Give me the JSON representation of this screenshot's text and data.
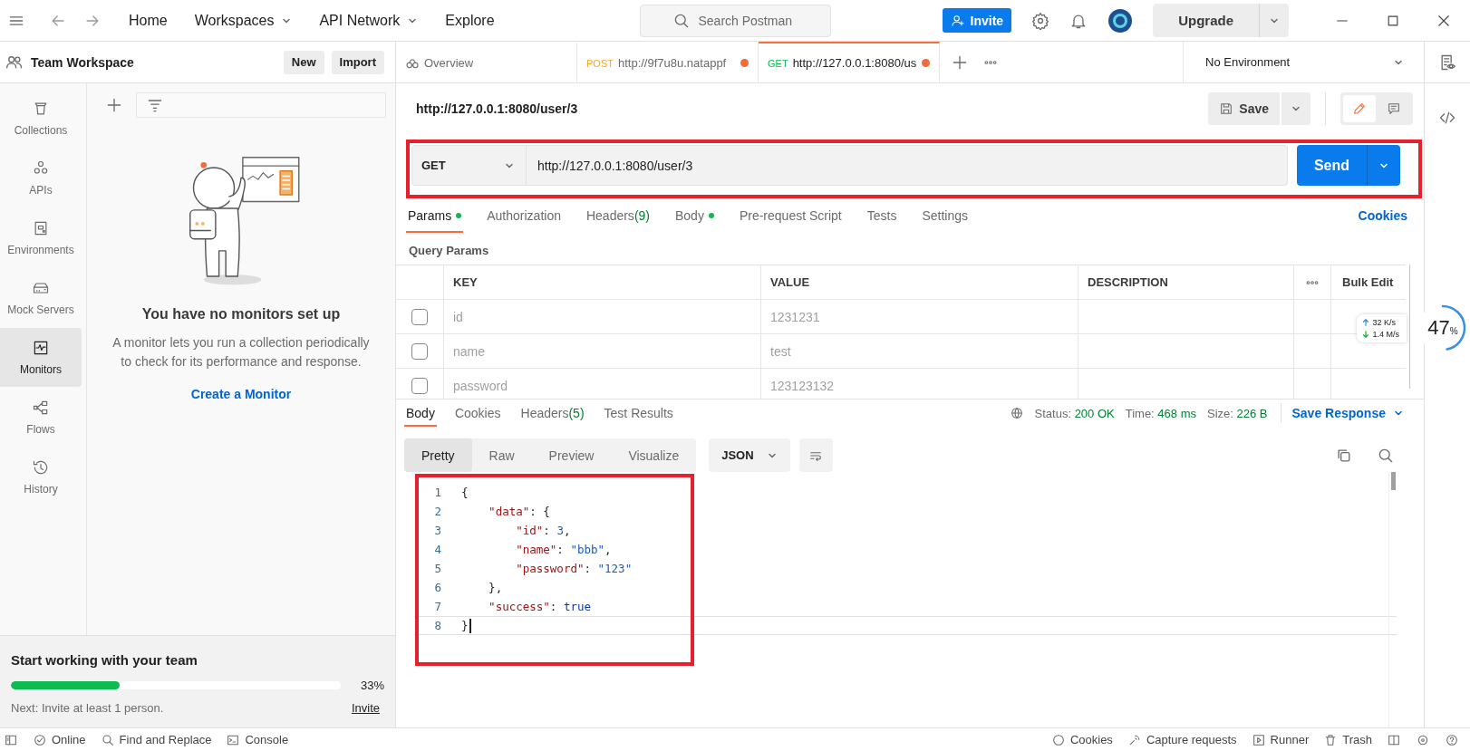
{
  "top_bar": {
    "nav": [
      {
        "label": "Home",
        "dropdown": false
      },
      {
        "label": "Workspaces",
        "dropdown": true
      },
      {
        "label": "API Network",
        "dropdown": true
      },
      {
        "label": "Explore",
        "dropdown": false
      }
    ],
    "search": {
      "placeholder": "Search Postman"
    },
    "invite": "Invite",
    "upgrade": "Upgrade"
  },
  "workspace": {
    "title": "Team Workspace",
    "buttons": [
      "New",
      "Import"
    ]
  },
  "sidebar": {
    "items": [
      {
        "label": "Collections",
        "selected": false
      },
      {
        "label": "APIs",
        "selected": false
      },
      {
        "label": "Environments",
        "selected": false
      },
      {
        "label": "Mock Servers",
        "selected": false
      },
      {
        "label": "Monitors",
        "selected": true
      },
      {
        "label": "Flows",
        "selected": false
      },
      {
        "label": "History",
        "selected": false
      }
    ]
  },
  "monitors_empty": {
    "title": "You have no monitors set up",
    "text": "A monitor lets you run a collection periodically to check for its performance and response.",
    "link": "Create a Monitor"
  },
  "onboarding": {
    "title": "Start working with your team",
    "level": 0.33,
    "percent": "33%",
    "next": "Next: Invite at least 1 person.",
    "link": "Invite"
  },
  "tabs": [
    {
      "kind": "overview",
      "label": "Overview",
      "selected": false,
      "modified": false
    },
    {
      "kind": "request",
      "method": "POST",
      "color": "#f5a623",
      "label": "http://9f7u8u.natappf",
      "selected": false,
      "modified": true
    },
    {
      "kind": "request",
      "method": "GET",
      "color": "#0cbb52",
      "label": "http://127.0.0.1:8080/us",
      "selected": true,
      "modified": true
    }
  ],
  "environment": {
    "label": "No Environment"
  },
  "request": {
    "name": "http://127.0.0.1:8080/user/3",
    "save": "Save",
    "method": "GET",
    "url": "http://127.0.0.1:8080/user/3",
    "send": "Send"
  },
  "request_sections": {
    "tabs": [
      {
        "label": "Params",
        "dot": true,
        "selected": true
      },
      {
        "label": "Authorization",
        "dot": false,
        "selected": false
      },
      {
        "label": "Headers",
        "count": "(9)",
        "dot": false,
        "selected": false
      },
      {
        "label": "Body",
        "dot": true,
        "selected": false
      },
      {
        "label": "Pre-request Script",
        "dot": false,
        "selected": false
      },
      {
        "label": "Tests",
        "dot": false,
        "selected": false
      },
      {
        "label": "Settings",
        "dot": false,
        "selected": false
      }
    ],
    "cookies": "Cookies"
  },
  "query_params": {
    "title": "Query Params",
    "columns": [
      "KEY",
      "VALUE",
      "DESCRIPTION"
    ],
    "bulk_edit": "Bulk Edit",
    "rows": [
      {
        "checked": false,
        "key": "id",
        "value": "1231231"
      },
      {
        "checked": false,
        "key": "name",
        "value": "test"
      },
      {
        "checked": false,
        "key": "password",
        "value": "123123132"
      }
    ]
  },
  "response": {
    "tabs": [
      {
        "label": "Body",
        "selected": true
      },
      {
        "label": "Cookies",
        "selected": false
      },
      {
        "label": "Headers",
        "count": "(5)",
        "selected": false
      },
      {
        "label": "Test Results",
        "selected": false
      }
    ],
    "status": {
      "label": "Status:",
      "value": "200 OK"
    },
    "time": {
      "label": "Time:",
      "value": "468 ms"
    },
    "size": {
      "label": "Size:",
      "value": "226 B"
    },
    "save_response": "Save Response",
    "views": [
      {
        "label": "Pretty",
        "selected": true
      },
      {
        "label": "Raw",
        "selected": false
      },
      {
        "label": "Preview",
        "selected": false
      },
      {
        "label": "Visualize",
        "selected": false
      }
    ],
    "format": "JSON",
    "lines": [
      {
        "number": "1",
        "current": false,
        "tokens": [
          {
            "kind": "punct",
            "text": "{"
          }
        ]
      },
      {
        "number": "2",
        "current": false,
        "tokens": [
          {
            "kind": "key",
            "text": "    \"data\""
          },
          {
            "kind": "punct",
            "text": ": {"
          }
        ]
      },
      {
        "number": "3",
        "current": false,
        "tokens": [
          {
            "kind": "key",
            "text": "        \"id\""
          },
          {
            "kind": "punct",
            "text": ": "
          },
          {
            "kind": "number",
            "text": "3"
          },
          {
            "kind": "punct",
            "text": ","
          }
        ]
      },
      {
        "number": "4",
        "current": false,
        "tokens": [
          {
            "kind": "key",
            "text": "        \"name\""
          },
          {
            "kind": "punct",
            "text": ": "
          },
          {
            "kind": "string",
            "text": "\"bbb\""
          },
          {
            "kind": "punct",
            "text": ","
          }
        ]
      },
      {
        "number": "5",
        "current": false,
        "tokens": [
          {
            "kind": "key",
            "text": "        \"password\""
          },
          {
            "kind": "punct",
            "text": ": "
          },
          {
            "kind": "string",
            "text": "\"123\""
          }
        ]
      },
      {
        "number": "6",
        "current": false,
        "tokens": [
          {
            "kind": "punct",
            "text": "    },"
          }
        ]
      },
      {
        "number": "7",
        "current": false,
        "tokens": [
          {
            "kind": "key",
            "text": "    \"success\""
          },
          {
            "kind": "punct",
            "text": ": "
          },
          {
            "kind": "bool",
            "text": "true"
          }
        ]
      },
      {
        "number": "8",
        "current": true,
        "tokens": [
          {
            "kind": "punct",
            "text": "}"
          }
        ]
      }
    ]
  },
  "status_bar": {
    "left": [
      "Online",
      "Find and Replace",
      "Console"
    ],
    "right": [
      "Cookies",
      "Capture requests",
      "Runner",
      "Trash"
    ]
  },
  "net_widget": {
    "up": "32 K/s",
    "down": "1.4 M/s",
    "level": 0.47,
    "percent": "47",
    "unit": "%"
  }
}
